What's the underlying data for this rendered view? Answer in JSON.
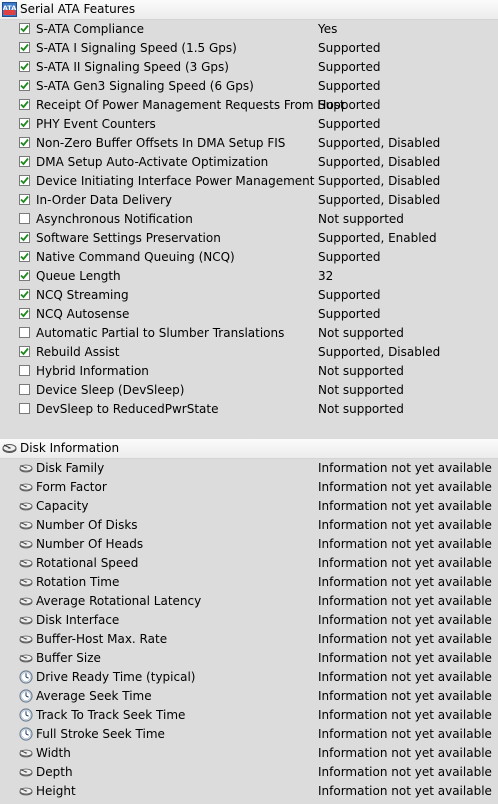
{
  "sata": {
    "title": "Serial ATA Features",
    "items": [
      {
        "name": "S-ATA Compliance",
        "value": "Yes",
        "checked": true
      },
      {
        "name": "S-ATA I Signaling Speed (1.5 Gps)",
        "value": "Supported",
        "checked": true
      },
      {
        "name": "S-ATA II Signaling Speed (3 Gps)",
        "value": "Supported",
        "checked": true
      },
      {
        "name": "S-ATA Gen3 Signaling Speed (6 Gps)",
        "value": "Supported",
        "checked": true
      },
      {
        "name": "Receipt Of Power Management Requests From Host",
        "value": "Supported",
        "checked": true
      },
      {
        "name": "PHY Event Counters",
        "value": "Supported",
        "checked": true
      },
      {
        "name": "Non-Zero Buffer Offsets In DMA Setup FIS",
        "value": "Supported, Disabled",
        "checked": true
      },
      {
        "name": "DMA Setup Auto-Activate Optimization",
        "value": "Supported, Disabled",
        "checked": true
      },
      {
        "name": "Device Initiating Interface Power Management",
        "value": "Supported, Disabled",
        "checked": true
      },
      {
        "name": "In-Order Data Delivery",
        "value": "Supported, Disabled",
        "checked": true
      },
      {
        "name": "Asynchronous Notification",
        "value": "Not supported",
        "checked": false
      },
      {
        "name": "Software Settings Preservation",
        "value": "Supported, Enabled",
        "checked": true
      },
      {
        "name": "Native Command Queuing (NCQ)",
        "value": "Supported",
        "checked": true
      },
      {
        "name": "Queue Length",
        "value": "32",
        "checked": true
      },
      {
        "name": "NCQ Streaming",
        "value": "Supported",
        "checked": true
      },
      {
        "name": "NCQ Autosense",
        "value": "Supported",
        "checked": true
      },
      {
        "name": "Automatic Partial to Slumber Translations",
        "value": "Not supported",
        "checked": false
      },
      {
        "name": "Rebuild Assist",
        "value": "Supported, Disabled",
        "checked": true
      },
      {
        "name": "Hybrid Information",
        "value": "Not supported",
        "checked": false
      },
      {
        "name": "Device Sleep (DevSleep)",
        "value": "Not supported",
        "checked": false
      },
      {
        "name": "DevSleep to ReducedPwrState",
        "value": "Not supported",
        "checked": false
      }
    ]
  },
  "disk": {
    "title": "Disk Information",
    "items": [
      {
        "name": "Disk Family",
        "value": "Information not yet available",
        "icon": "disk-icon"
      },
      {
        "name": "Form Factor",
        "value": "Information not yet available",
        "icon": "disk-icon"
      },
      {
        "name": "Capacity",
        "value": "Information not yet available",
        "icon": "disk-icon"
      },
      {
        "name": "Number Of Disks",
        "value": "Information not yet available",
        "icon": "disk-icon"
      },
      {
        "name": "Number Of Heads",
        "value": "Information not yet available",
        "icon": "disk-icon"
      },
      {
        "name": "Rotational Speed",
        "value": "Information not yet available",
        "icon": "disk-icon"
      },
      {
        "name": "Rotation Time",
        "value": "Information not yet available",
        "icon": "disk-icon"
      },
      {
        "name": "Average Rotational Latency",
        "value": "Information not yet available",
        "icon": "disk-icon"
      },
      {
        "name": "Disk Interface",
        "value": "Information not yet available",
        "icon": "disk-icon"
      },
      {
        "name": "Buffer-Host Max. Rate",
        "value": "Information not yet available",
        "icon": "disk-icon"
      },
      {
        "name": "Buffer Size",
        "value": "Information not yet available",
        "icon": "disk-icon"
      },
      {
        "name": "Drive Ready Time (typical)",
        "value": "Information not yet available",
        "icon": "clock-icon"
      },
      {
        "name": "Average Seek Time",
        "value": "Information not yet available",
        "icon": "clock-icon"
      },
      {
        "name": "Track To Track Seek Time",
        "value": "Information not yet available",
        "icon": "clock-icon"
      },
      {
        "name": "Full Stroke Seek Time",
        "value": "Information not yet available",
        "icon": "clock-icon"
      },
      {
        "name": "Width",
        "value": "Information not yet available",
        "icon": "disk-icon"
      },
      {
        "name": "Depth",
        "value": "Information not yet available",
        "icon": "disk-icon"
      },
      {
        "name": "Height",
        "value": "Information not yet available",
        "icon": "disk-icon"
      }
    ]
  },
  "header_icons": {
    "sata": {
      "label": "ATA",
      "name": "ata-icon"
    },
    "disk": {
      "name": "disk-icon"
    }
  }
}
